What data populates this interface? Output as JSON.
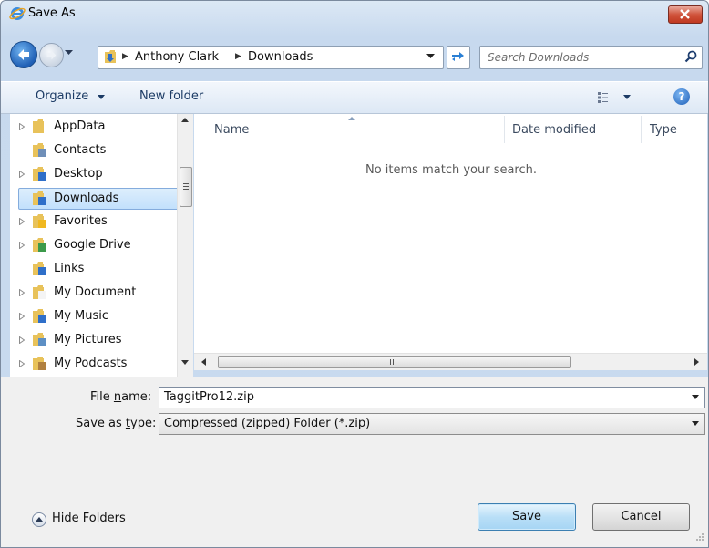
{
  "window": {
    "title": "Save As"
  },
  "address": {
    "crumbs": [
      "Anthony Clark",
      "Downloads"
    ]
  },
  "search": {
    "placeholder": "Search Downloads"
  },
  "toolbar": {
    "organize_label": "Organize",
    "new_folder_label": "New folder"
  },
  "nav": {
    "items": [
      {
        "label": "AppData",
        "expandable": true,
        "icon": "folder-icon"
      },
      {
        "label": "Contacts",
        "expandable": false,
        "icon": "contacts-folder-icon"
      },
      {
        "label": "Desktop",
        "expandable": true,
        "icon": "desktop-folder-icon"
      },
      {
        "label": "Downloads",
        "expandable": false,
        "icon": "downloads-folder-icon",
        "selected": true
      },
      {
        "label": "Favorites",
        "expandable": true,
        "icon": "favorites-folder-icon"
      },
      {
        "label": "Google Drive",
        "expandable": true,
        "icon": "google-drive-folder-icon"
      },
      {
        "label": "Links",
        "expandable": false,
        "icon": "links-folder-icon"
      },
      {
        "label": "My Document",
        "expandable": true,
        "icon": "documents-folder-icon"
      },
      {
        "label": "My Music",
        "expandable": true,
        "icon": "music-folder-icon"
      },
      {
        "label": "My Pictures",
        "expandable": true,
        "icon": "pictures-folder-icon"
      },
      {
        "label": "My Podcasts",
        "expandable": true,
        "icon": "podcasts-folder-icon"
      }
    ]
  },
  "file_list": {
    "columns": [
      "Name",
      "Date modified",
      "Type"
    ],
    "empty_message": "No items match your search."
  },
  "form": {
    "file_name_label_pre": "File ",
    "file_name_label_key": "n",
    "file_name_label_post": "ame:",
    "file_name_value": "TaggitPro12.zip",
    "save_type_label_pre": "Save as ",
    "save_type_label_key": "t",
    "save_type_label_post": "ype:",
    "save_type_value": "Compressed (zipped) Folder (*.zip)"
  },
  "footer": {
    "hide_folders_label": "Hide Folders",
    "save_label": "Save",
    "cancel_label": "Cancel"
  },
  "colors": {
    "selection": "#c2e0fc",
    "accent_blue": "#1f5fb5",
    "close_red": "#c03820"
  }
}
